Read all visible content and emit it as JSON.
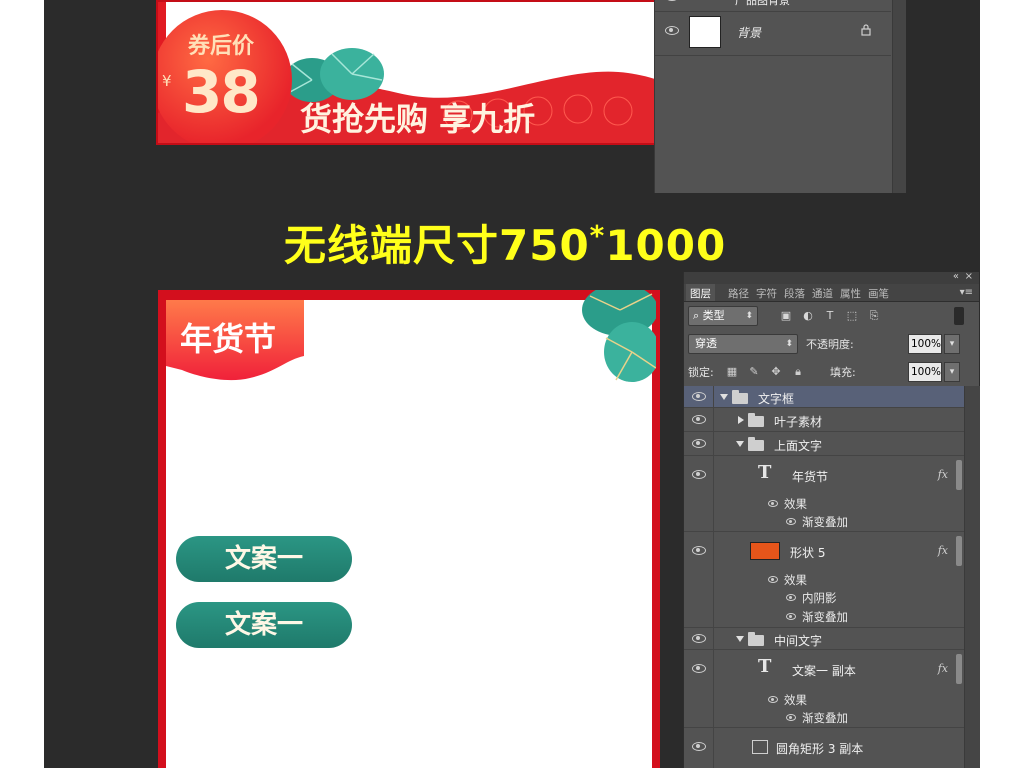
{
  "banner": {
    "price_label": "券后价",
    "currency": "¥",
    "price": "38",
    "slogan": "货抢先购 享九折"
  },
  "ps_top": {
    "layer_partial": "产品图背景",
    "background_layer": "背景"
  },
  "headline": {
    "text": "无线端尺寸750",
    "sup": "*",
    "size_tail": "1000"
  },
  "page": {
    "tag_text": "年货节",
    "button1": "文案一",
    "button2": "文案一"
  },
  "ps_panel": {
    "tabs": [
      "图层",
      "路径",
      "字符",
      "段落",
      "通道",
      "属性",
      "画笔"
    ],
    "filter_type": "类型",
    "blend_mode": "穿透",
    "opacity_label": "不透明度:",
    "opacity_value": "100%",
    "lock_label": "锁定:",
    "fill_label": "填充:",
    "fill_value": "100%",
    "layers": {
      "group_wenzikuang": "文字框",
      "group_yezi": "叶子素材",
      "group_shangmian": "上面文字",
      "text_nianhuojie": "年货节",
      "effect1": "效果",
      "effect1_item": "渐变叠加",
      "shape5": "形状 5",
      "effect2": "效果",
      "effect2_item1": "内阴影",
      "effect2_item2": "渐变叠加",
      "group_zhongjian": "中间文字",
      "text_wenan_copy": "文案一 副本",
      "effect3": "效果",
      "effect3_item": "渐变叠加",
      "rounded_rect": "圆角矩形 3 副本"
    },
    "fx_label": "fx"
  },
  "colors": {
    "stage_bg": "#2b2b2b",
    "headline": "#ffff1a",
    "red": "#d30f1d",
    "teal": "#1f7a6b",
    "ps_panel": "#535353",
    "selected_row": "#586178"
  },
  "icons": [
    "eye-icon",
    "lock-icon",
    "folder-icon",
    "text-layer-icon",
    "fx-icon",
    "search-icon",
    "image-filter-icon",
    "adjust-filter-icon",
    "type-filter-icon",
    "shape-filter-icon",
    "smart-filter-icon",
    "move-lock-icon",
    "brush-lock-icon",
    "pixel-lock-icon"
  ]
}
